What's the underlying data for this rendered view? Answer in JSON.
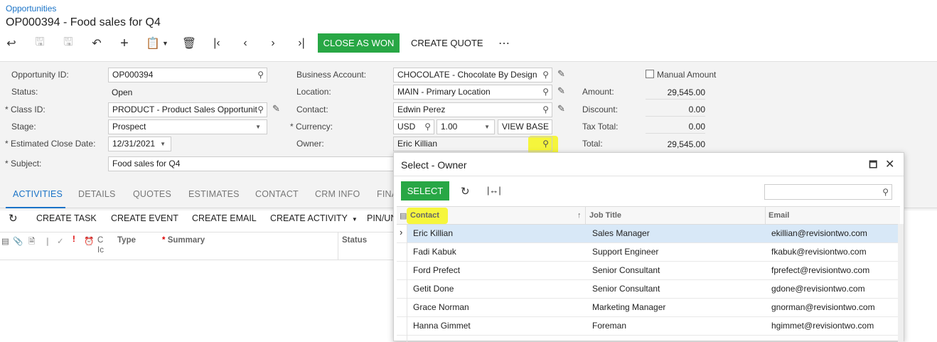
{
  "breadcrumb": "Opportunities",
  "page_title": "OP000394 - Food sales for Q4",
  "toolbar": {
    "close_as_won": "CLOSE AS WON",
    "create_quote": "CREATE QUOTE",
    "more": "⋯"
  },
  "form": {
    "opportunity_id_label": "Opportunity ID:",
    "opportunity_id": "OP000394",
    "status_label": "Status:",
    "status": "Open",
    "class_id_label": "Class ID:",
    "class_id": "PRODUCT - Product Sales Opportunit",
    "stage_label": "Stage:",
    "stage": "Prospect",
    "close_date_label": "Estimated Close Date:",
    "close_date": "12/31/2021",
    "subject_label": "Subject:",
    "subject": "Food sales for Q4",
    "business_account_label": "Business Account:",
    "business_account": "CHOCOLATE - Chocolate By Design",
    "location_label": "Location:",
    "location": "MAIN - Primary Location",
    "contact_label": "Contact:",
    "contact": "Edwin Perez",
    "currency_label": "Currency:",
    "currency": "USD",
    "rate": "1.00",
    "view_base": "VIEW BASE",
    "owner_label": "Owner:",
    "owner": "Eric Killian",
    "manual_amount_label": "Manual Amount",
    "amount_label": "Amount:",
    "amount": "29,545.00",
    "discount_label": "Discount:",
    "discount": "0.00",
    "tax_total_label": "Tax Total:",
    "tax_total": "0.00",
    "total_label": "Total:",
    "total": "29,545.00"
  },
  "tabs": [
    "ACTIVITIES",
    "DETAILS",
    "QUOTES",
    "ESTIMATES",
    "CONTACT",
    "CRM INFO",
    "FINA"
  ],
  "activity_actions": [
    "CREATE TASK",
    "CREATE EVENT",
    "CREATE EMAIL",
    "CREATE ACTIVITY",
    "PIN/UN"
  ],
  "activity_columns": {
    "c": "C",
    "l": "Ic",
    "type": "Type",
    "summary": "Summary",
    "status": "Status"
  },
  "dialog": {
    "title": "Select - Owner",
    "select_button": "SELECT",
    "columns": {
      "contact": "Contact",
      "job_title": "Job Title",
      "email": "Email"
    },
    "rows": [
      {
        "contact": "Eric Killian",
        "job_title": "Sales Manager",
        "email": "ekillian@revisiontwo.com"
      },
      {
        "contact": "Fadi Kabuk",
        "job_title": "Support Engineer",
        "email": "fkabuk@revisiontwo.com"
      },
      {
        "contact": "Ford Prefect",
        "job_title": "Senior Consultant",
        "email": "fprefect@revisiontwo.com"
      },
      {
        "contact": "Getit Done",
        "job_title": "Senior Consultant",
        "email": "gdone@revisiontwo.com"
      },
      {
        "contact": "Grace Norman",
        "job_title": "Marketing Manager",
        "email": "gnorman@revisiontwo.com"
      },
      {
        "contact": "Hanna Gimmet",
        "job_title": "Foreman",
        "email": "hgimmet@revisiontwo.com"
      }
    ]
  },
  "colors": {
    "accent": "#1a73c7",
    "success": "#28a745",
    "highlight": "#f5f528"
  }
}
